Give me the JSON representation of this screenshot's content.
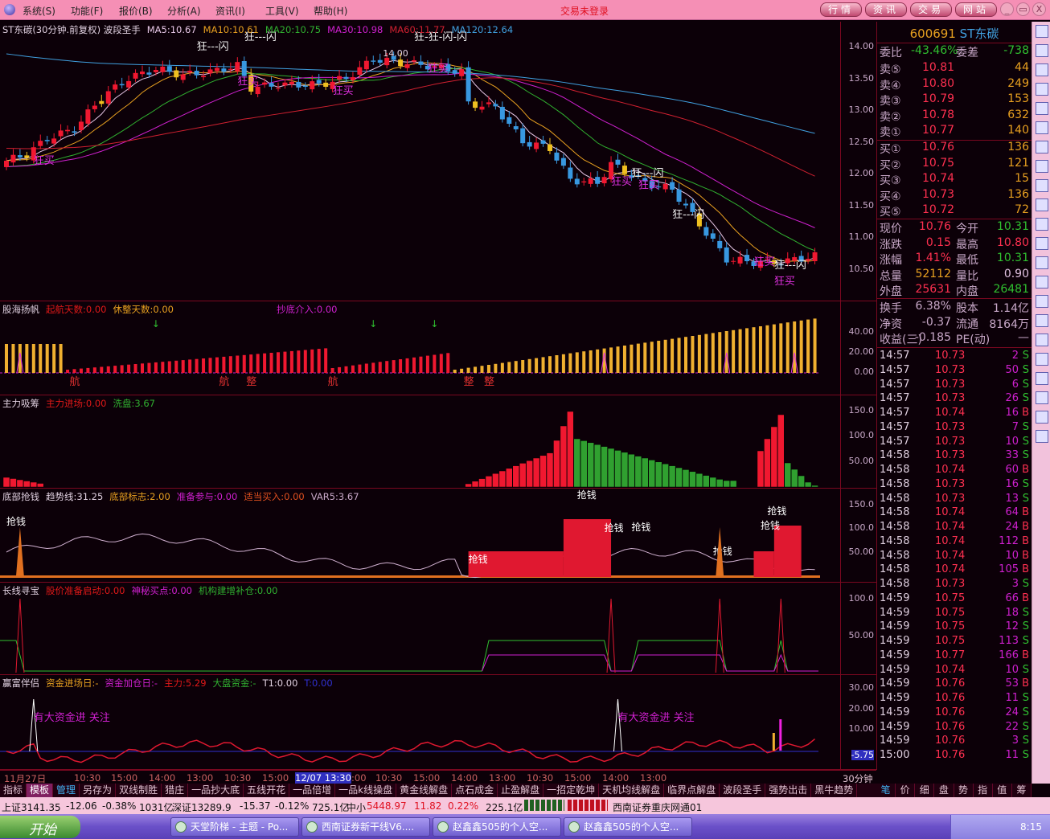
{
  "menu": {
    "items": [
      "系统(S)",
      "功能(F)",
      "报价(B)",
      "分析(A)",
      "资讯(I)",
      "工具(V)",
      "帮助(H)"
    ],
    "login_status": "交易未登录",
    "nav": [
      "行情",
      "资讯",
      "交易",
      "网站"
    ],
    "window": [
      "_",
      "▭",
      "X"
    ]
  },
  "main": {
    "title": "ST东碳(30分钟.前复权) 波段圣手",
    "ma": [
      {
        "label": "MA5:10.67",
        "color": "#e8c8e8"
      },
      {
        "label": "MA10:10.61",
        "color": "#e8a020"
      },
      {
        "label": "MA20:10.75",
        "color": "#30b030"
      },
      {
        "label": "MA30:10.98",
        "color": "#d020d0"
      },
      {
        "label": "MA60:11.77",
        "color": "#d02030"
      },
      {
        "label": "MA120:12.64",
        "color": "#40a0e0"
      }
    ],
    "yticks": [
      "14.00",
      "13.50",
      "13.00",
      "12.50",
      "12.00",
      "11.50",
      "11.00",
      "10.50"
    ],
    "price_path": [
      [
        0,
        12.2
      ],
      [
        3,
        12.3
      ],
      [
        6,
        12.55
      ],
      [
        10,
        12.7
      ],
      [
        14,
        13.2
      ],
      [
        18,
        13.5
      ],
      [
        22,
        13.65
      ],
      [
        26,
        13.55
      ],
      [
        30,
        13.6
      ],
      [
        34,
        13.7
      ],
      [
        36,
        13.35
      ],
      [
        40,
        13.4
      ],
      [
        46,
        13.4
      ],
      [
        50,
        13.5
      ],
      [
        54,
        13.8
      ],
      [
        58,
        13.75
      ],
      [
        62,
        13.7
      ],
      [
        67,
        13.6
      ],
      [
        68,
        13.1
      ],
      [
        72,
        13.05
      ],
      [
        76,
        12.5
      ],
      [
        80,
        12.4
      ],
      [
        83,
        11.9
      ],
      [
        87,
        11.85
      ],
      [
        89,
        12.15
      ],
      [
        94,
        11.85
      ],
      [
        98,
        11.75
      ],
      [
        102,
        11.2
      ],
      [
        106,
        10.65
      ],
      [
        110,
        10.6
      ],
      [
        114,
        10.6
      ],
      [
        119,
        10.7
      ]
    ],
    "high_label": "14.00",
    "annotations": [
      {
        "t": "狂买",
        "i": 4,
        "p": 12.15
      },
      {
        "t": "狂---闪",
        "i": 28,
        "p": 13.95
      },
      {
        "t": "狂---闪",
        "i": 35,
        "p": 14.1
      },
      {
        "t": "狂买",
        "i": 34,
        "p": 13.4
      },
      {
        "t": "狂买",
        "i": 48,
        "p": 13.25
      },
      {
        "t": "狂-狂-闪-闪",
        "i": 60,
        "p": 14.1
      },
      {
        "t": "狂买",
        "i": 62,
        "p": 13.6
      },
      {
        "t": "狂---闪",
        "i": 92,
        "p": 11.95
      },
      {
        "t": "狂买",
        "i": 89,
        "p": 11.82
      },
      {
        "t": "狂买",
        "i": 93,
        "p": 11.76
      },
      {
        "t": "狂---闪",
        "i": 98,
        "p": 11.3
      },
      {
        "t": "狂买",
        "i": 110,
        "p": 10.55
      },
      {
        "t": "狂---闪",
        "i": 113,
        "p": 10.5
      },
      {
        "t": "狂买",
        "i": 113,
        "p": 10.25
      }
    ]
  },
  "p2": {
    "title": "股海扬帆",
    "fields": [
      {
        "label": "起航天数:0.00",
        "color": "#e01818"
      },
      {
        "label": "休整天数:0.00",
        "color": "#e8a020"
      },
      {
        "label": "抄底介入:0.00",
        "color": "#d020d0"
      }
    ],
    "yticks": [
      "40.00",
      "20.00",
      "0.00"
    ],
    "marks": [
      {
        "t": "航",
        "i": 10
      },
      {
        "t": "航",
        "i": 32
      },
      {
        "t": "整",
        "i": 36
      },
      {
        "t": "航",
        "i": 48
      },
      {
        "t": "整",
        "i": 68
      },
      {
        "t": "整",
        "i": 71
      }
    ]
  },
  "p3": {
    "title": "主力吸筹",
    "fields": [
      {
        "label": "主力进场:0.00",
        "color": "#e01818"
      },
      {
        "label": "洗盘:3.67",
        "color": "#30b030"
      }
    ],
    "yticks": [
      "150.0",
      "100.0",
      "50.00"
    ]
  },
  "p4": {
    "title": "底部抢钱",
    "fields": [
      {
        "label": "趋势线:31.25",
        "color": "#e0d0e0"
      },
      {
        "label": "底部标志:2.00",
        "color": "#e8a020"
      },
      {
        "label": "准备参与:0.00",
        "color": "#d020d0"
      },
      {
        "label": "适当买入:0.00",
        "color": "#e05020"
      },
      {
        "label": "VAR5:3.67",
        "color": "#c8a8c8"
      }
    ],
    "yticks": [
      "150.0",
      "100.0",
      "50.00"
    ],
    "mark": "抢钱"
  },
  "p5": {
    "title": "长线寻宝",
    "fields": [
      {
        "label": "股价准备启动:0.00",
        "color": "#e01818"
      },
      {
        "label": "神秘买点:0.00",
        "color": "#d020d0"
      },
      {
        "label": "机构建增补仓:0.00",
        "color": "#30b030"
      }
    ],
    "yticks": [
      "100.0",
      "50.00"
    ]
  },
  "p6": {
    "title": "赢富伴侣",
    "fields": [
      {
        "label": "资金进场日:-",
        "color": "#e8a020"
      },
      {
        "label": "资金加仓日:-",
        "color": "#d020d0"
      },
      {
        "label": "主力:5.29",
        "color": "#e01818"
      },
      {
        "label": "大盘资金:-",
        "color": "#30b030"
      },
      {
        "label": "T1:0.00",
        "color": "#e0d0e0"
      },
      {
        "label": "T:0.00",
        "color": "#3030d0"
      }
    ],
    "yticks": [
      "30.00",
      "20.00",
      "10.00",
      "-5.75"
    ],
    "mark": "有大资金进  关注"
  },
  "xaxis": {
    "labels": [
      "11月27日",
      "10:30",
      "15:00",
      "14:00",
      "13:00",
      "10:30",
      "15:00",
      "12/07 13:30",
      ":00",
      "10:30",
      "15:00",
      "14:00",
      "13:00",
      "10:30",
      "15:00",
      "14:00",
      "13:00"
    ],
    "period": "30分钟"
  },
  "quote": {
    "code": "600691",
    "name": "ST东碳",
    "weibi_label": "委比",
    "weibi": "-43.46%",
    "weicha_label": "委差",
    "weicha": "-738",
    "asks": [
      {
        "l": "卖⑤",
        "p": "10.81",
        "v": "44"
      },
      {
        "l": "卖④",
        "p": "10.80",
        "v": "249"
      },
      {
        "l": "卖③",
        "p": "10.79",
        "v": "153"
      },
      {
        "l": "卖②",
        "p": "10.78",
        "v": "632"
      },
      {
        "l": "卖①",
        "p": "10.77",
        "v": "140"
      }
    ],
    "bids": [
      {
        "l": "买①",
        "p": "10.76",
        "v": "136"
      },
      {
        "l": "买②",
        "p": "10.75",
        "v": "121"
      },
      {
        "l": "买③",
        "p": "10.74",
        "v": "15"
      },
      {
        "l": "买④",
        "p": "10.73",
        "v": "136"
      },
      {
        "l": "买⑤",
        "p": "10.72",
        "v": "72"
      }
    ],
    "stats": [
      [
        "现价",
        "10.76",
        "#ff3050",
        "今开",
        "10.31",
        "#30c030"
      ],
      [
        "涨跌",
        "0.15",
        "#ff3050",
        "最高",
        "10.80",
        "#ff3050"
      ],
      [
        "涨幅",
        "1.41%",
        "#ff3050",
        "最低",
        "10.31",
        "#30c030"
      ],
      [
        "总量",
        "52112",
        "#e8a020",
        "量比",
        "0.90",
        "#e0c0e0"
      ],
      [
        "外盘",
        "25631",
        "#ff3050",
        "内盘",
        "26481",
        "#30c030"
      ]
    ],
    "info": [
      [
        "换手",
        "6.38%",
        "股本",
        "1.14亿"
      ],
      [
        "净资",
        "-0.37",
        "流通",
        "8164万"
      ],
      [
        "收益(三)",
        "-0.185",
        "PE(动)",
        "—"
      ]
    ]
  },
  "ticks": [
    [
      "14:57",
      "10.73",
      "2",
      "S"
    ],
    [
      "14:57",
      "10.73",
      "50",
      "S"
    ],
    [
      "14:57",
      "10.73",
      "6",
      "S"
    ],
    [
      "14:57",
      "10.73",
      "26",
      "S"
    ],
    [
      "14:57",
      "10.74",
      "16",
      "B"
    ],
    [
      "14:57",
      "10.73",
      "7",
      "S"
    ],
    [
      "14:57",
      "10.73",
      "10",
      "S"
    ],
    [
      "14:58",
      "10.73",
      "33",
      "S"
    ],
    [
      "14:58",
      "10.74",
      "60",
      "B"
    ],
    [
      "14:58",
      "10.73",
      "16",
      "S"
    ],
    [
      "14:58",
      "10.73",
      "13",
      "S"
    ],
    [
      "14:58",
      "10.74",
      "64",
      "B"
    ],
    [
      "14:58",
      "10.74",
      "24",
      "B"
    ],
    [
      "14:58",
      "10.74",
      "112",
      "B"
    ],
    [
      "14:58",
      "10.74",
      "10",
      "B"
    ],
    [
      "14:58",
      "10.74",
      "105",
      "B"
    ],
    [
      "14:58",
      "10.73",
      "3",
      "S"
    ],
    [
      "14:59",
      "10.75",
      "66",
      "B"
    ],
    [
      "14:59",
      "10.75",
      "18",
      "S"
    ],
    [
      "14:59",
      "10.75",
      "12",
      "S"
    ],
    [
      "14:59",
      "10.75",
      "113",
      "S"
    ],
    [
      "14:59",
      "10.77",
      "166",
      "B"
    ],
    [
      "14:59",
      "10.74",
      "10",
      "S"
    ],
    [
      "14:59",
      "10.76",
      "53",
      "B"
    ],
    [
      "14:59",
      "10.76",
      "11",
      "S"
    ],
    [
      "14:59",
      "10.76",
      "24",
      "S"
    ],
    [
      "14:59",
      "10.76",
      "22",
      "S"
    ],
    [
      "14:59",
      "10.76",
      "3",
      "S"
    ],
    [
      "15:00",
      "10.76",
      "11",
      "S"
    ]
  ],
  "tabs": [
    "指标",
    "模板",
    "管理",
    "另存为",
    "双线制胜",
    "猎庄",
    "一品抄大底",
    "五线开花",
    "一品倍增",
    "一品k线操盘",
    "黄金线解盘",
    "点石成金",
    "止盈解盘",
    "一招定乾坤",
    "天机均线解盘",
    "临界点解盘",
    "波段圣手",
    "强势出击",
    "黑牛趋势"
  ],
  "right_tabs": [
    "笔",
    "价",
    "细",
    "盘",
    "势",
    "指",
    "值",
    "筹"
  ],
  "status": {
    "sh": "上证3141.35",
    "sh_chg": "-12.06",
    "sh_pct": "-0.38%",
    "sh_amt": "1031亿",
    "sz": "深证13289.9",
    "sz_chg": "-15.37",
    "sz_pct": "-0.12%",
    "sz_amt": "725.1亿",
    "zx_label": "中小",
    "zx": "5448.97",
    "zx_chg": "11.82",
    "zx_pct": "0.22%",
    "zx_amt": "225.1亿",
    "broker": "西南证券重庆网通01"
  },
  "taskbar": {
    "start": "开始",
    "tasks": [
      "天堂阶梯 - 主题 - Po...",
      "西南证券新干线V6....",
      "赵鑫鑫505的个人空...",
      "赵鑫鑫505的个人空..."
    ],
    "clock": "8:15"
  },
  "colors": {
    "up": "#f01830",
    "down": "#3898e0",
    "bg": "#0c0008",
    "grid": "#7a0820"
  }
}
